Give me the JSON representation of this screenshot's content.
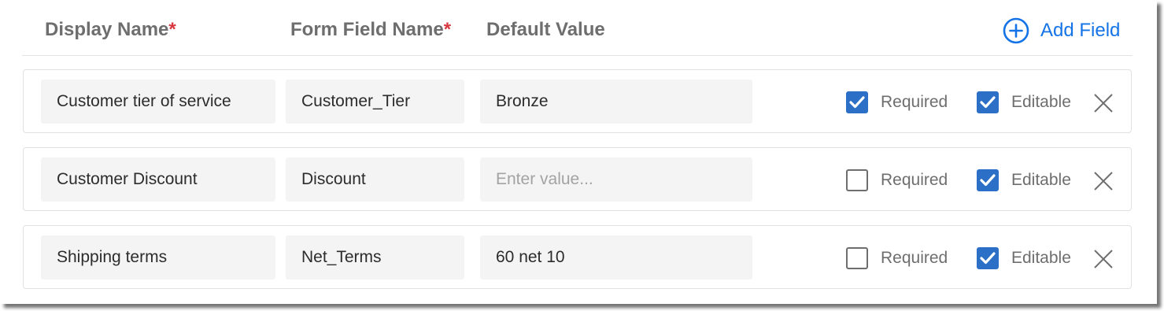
{
  "header": {
    "display_name": "Display Name",
    "form_field_name": "Form Field Name",
    "default_value": "Default Value",
    "required_marker": "*",
    "add_field": "Add Field"
  },
  "colors": {
    "accent": "#1473e6",
    "checkbox_checked": "#2b6fc7",
    "required_asterisk": "#d7373f",
    "input_background": "#f4f4f4"
  },
  "rows": [
    {
      "display_name": "Customer tier of service",
      "form_field_name": "Customer_Tier",
      "default_value": "Bronze",
      "default_placeholder": "",
      "required_label": "Required",
      "required": true,
      "editable_label": "Editable",
      "editable": true
    },
    {
      "display_name": "Customer Discount",
      "form_field_name": "Discount",
      "default_value": "",
      "default_placeholder": "Enter value...",
      "required_label": "Required",
      "required": false,
      "editable_label": "Editable",
      "editable": true
    },
    {
      "display_name": "Shipping terms",
      "form_field_name": "Net_Terms",
      "default_value": "60 net 10",
      "default_placeholder": "",
      "required_label": "Required",
      "required": false,
      "editable_label": "Editable",
      "editable": true
    }
  ],
  "icons": {
    "add": "plus-circle-icon",
    "checked": "checkmark-icon",
    "remove": "close-icon"
  }
}
